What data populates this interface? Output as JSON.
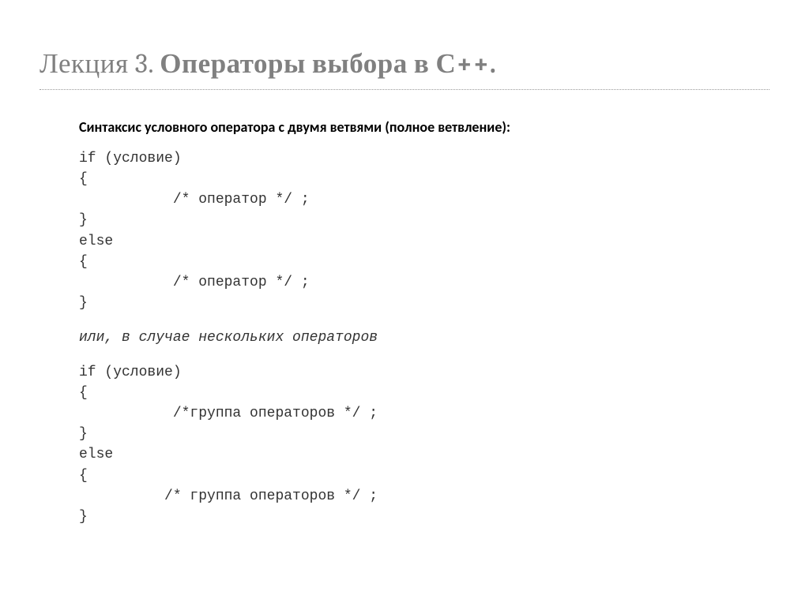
{
  "slide": {
    "title_light": "Лекция 3. ",
    "title_bold": "Операторы выбора в С++.",
    "subtitle": "Синтаксис условного оператора с двумя ветвями (полное ветвление):",
    "code1": "if (условие)\n{\n           /* оператор */ ;\n}\nelse\n{\n           /* оператор */ ;\n}",
    "note": "или, в случае нескольких операторов",
    "code2": "if (условие)\n{\n           /*группа операторов */ ;\n}\nelse\n{\n          /* группа операторов */ ;\n}"
  }
}
